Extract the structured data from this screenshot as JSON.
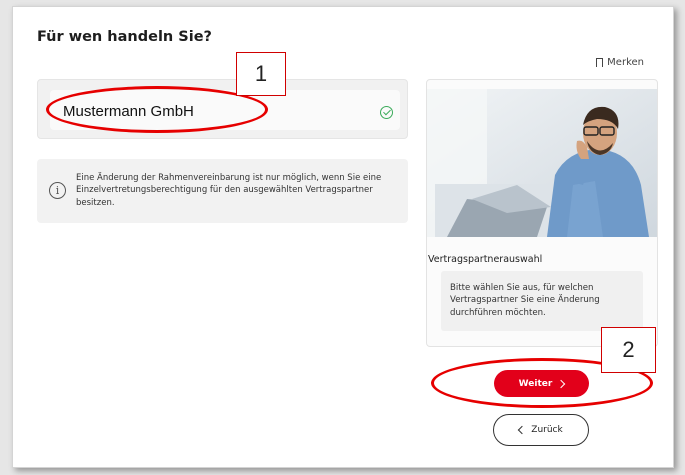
{
  "page": {
    "title": "Für wen handeln Sie?",
    "bookmark_label": "Merken"
  },
  "partner": {
    "name": "Mustermann GmbH",
    "selected": true
  },
  "info": {
    "text": "Eine Änderung der Rahmenvereinbarung ist nur möglich, wenn Sie eine Einzelvertretungsberechtigung für den ausgewählten Vertragspartner besitzen."
  },
  "side_panel": {
    "title": "Vertragspartnerauswahl",
    "note": "Bitte wählen Sie aus, für welchen Vertragspartner Sie eine Änderung durchführen möchten."
  },
  "buttons": {
    "next_label": "Weiter",
    "back_label": "Zurück"
  },
  "annotations": {
    "marker_1": "1",
    "marker_2": "2"
  },
  "colors": {
    "accent": "#e2001a",
    "success": "#3bab5a",
    "annotation": "#e60000"
  }
}
